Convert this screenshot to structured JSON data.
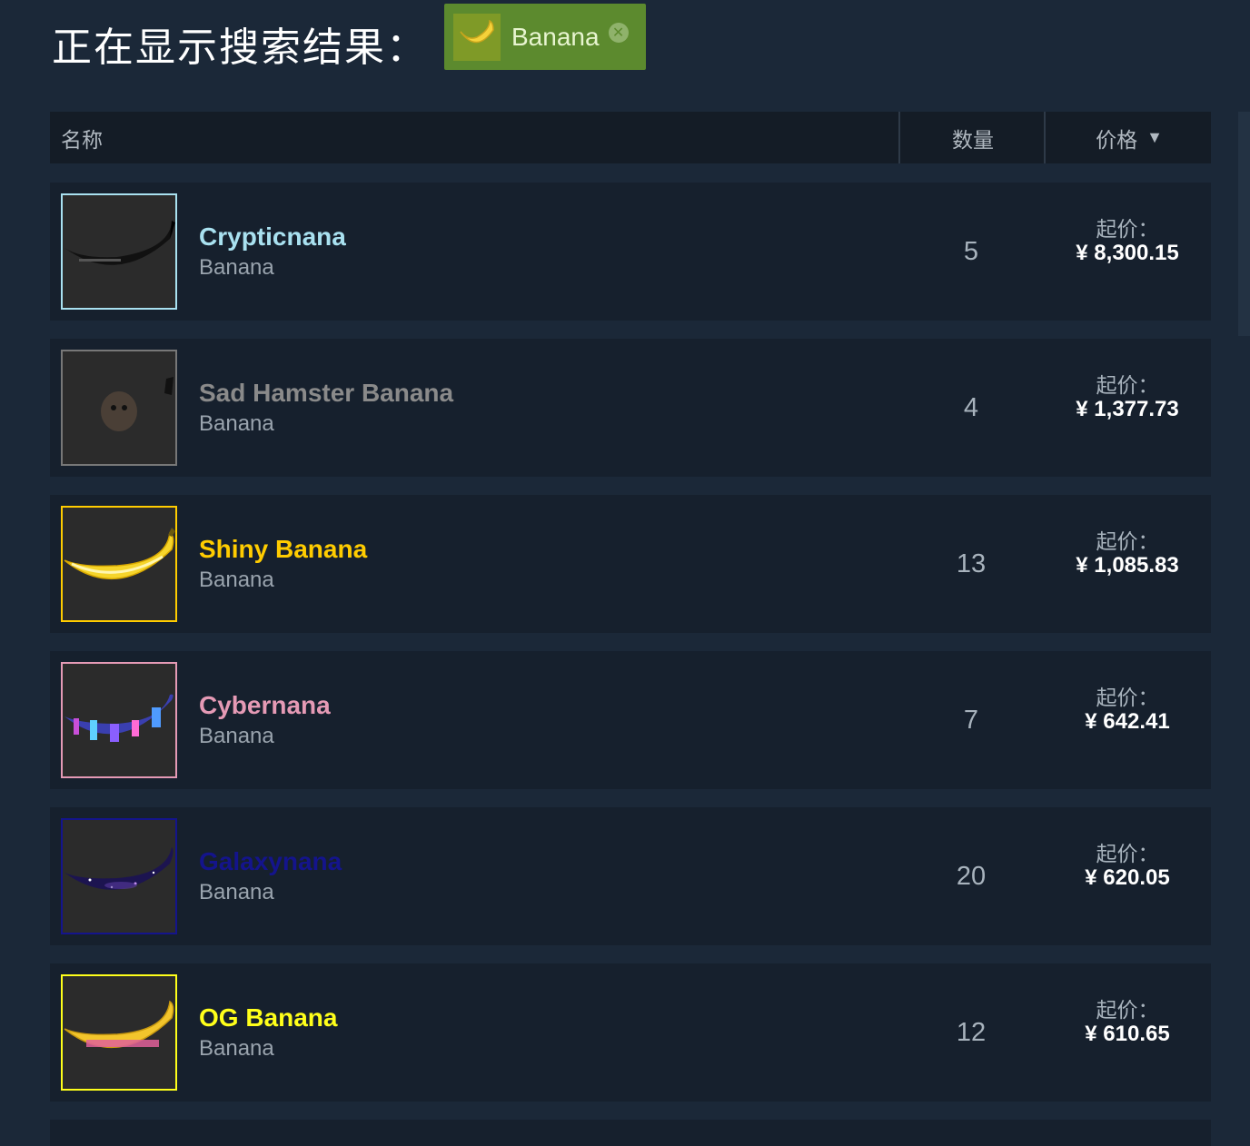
{
  "header": {
    "title": "正在显示搜索结果：",
    "filter": {
      "label": "Banana",
      "close_icon": "close-icon"
    }
  },
  "table": {
    "columns": {
      "name": "名称",
      "quantity": "数量",
      "price": "价格",
      "sort_indicator": "▼"
    }
  },
  "items": [
    {
      "name": "Crypticnana",
      "game": "Banana",
      "quantity": "5",
      "price_label": "起价：",
      "price": "¥ 8,300.15",
      "name_color": "#a9e1f0",
      "border_color": "#a9e1f0",
      "icon": "black-banana-icon"
    },
    {
      "name": "Sad Hamster Banana",
      "game": "Banana",
      "quantity": "4",
      "price_label": "起价：",
      "price": "¥ 1,377.73",
      "name_color": "#8a8a8a",
      "border_color": "#777777",
      "icon": "hamster-banana-icon"
    },
    {
      "name": "Shiny Banana",
      "game": "Banana",
      "quantity": "13",
      "price_label": "起价：",
      "price": "¥ 1,085.83",
      "name_color": "#ffcc00",
      "border_color": "#ffcc00",
      "icon": "shiny-banana-icon"
    },
    {
      "name": "Cybernana",
      "game": "Banana",
      "quantity": "7",
      "price_label": "起价：",
      "price": "¥ 642.41",
      "name_color": "#e59ab5",
      "border_color": "#e59ab5",
      "icon": "cyber-banana-icon"
    },
    {
      "name": "Galaxynana",
      "game": "Banana",
      "quantity": "20",
      "price_label": "起价：",
      "price": "¥ 620.05",
      "name_color": "#14148c",
      "border_color": "#14148c",
      "icon": "galaxy-banana-icon"
    },
    {
      "name": "OG Banana",
      "game": "Banana",
      "quantity": "12",
      "price_label": "起价：",
      "price": "¥ 610.65",
      "name_color": "#ffff1a",
      "border_color": "#ffff1a",
      "icon": "og-banana-icon"
    }
  ]
}
